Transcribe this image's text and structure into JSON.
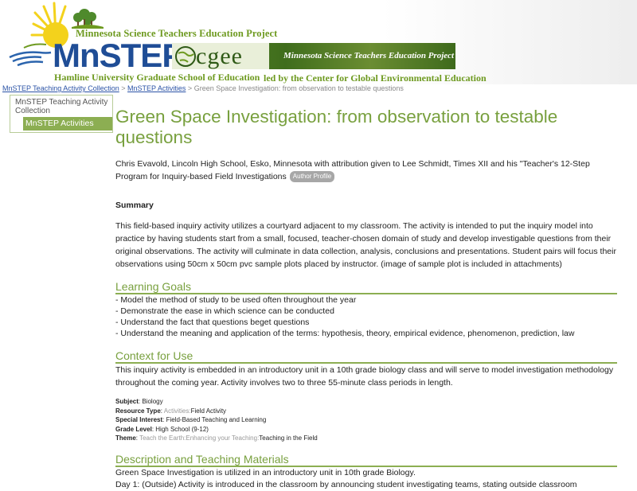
{
  "header": {
    "project_top": "Minnesota Science Teachers Education Project",
    "logo_word": "MnSTEP",
    "hamline": "Hamline University Graduate School of Education",
    "cgee_word": "cgee",
    "cgee_tagline": "Minnesota Science Teachers Education Project",
    "cgee_led_by": "led by the Center for Global Environmental Education",
    "colors": {
      "green": "#6e9a20",
      "blue": "#1f4d96",
      "sun": "#f3d21c"
    }
  },
  "breadcrumb": {
    "items": [
      {
        "label": "MnSTEP Teaching Activity Collection",
        "link": true
      },
      {
        "label": "MnSTEP Activities",
        "link": true
      },
      {
        "label": "Green Space Investigation: from observation to testable questions",
        "link": false
      }
    ],
    "separator": ">"
  },
  "sidebar": {
    "parent": "MnSTEP Teaching Activity Collection",
    "current": "MnSTEP Activities"
  },
  "page": {
    "title": "Green Space Investigation: from observation to testable questions",
    "author": "Chris Evavold, Lincoln High School, Esko, Minnesota with attribution given to Lee Schmidt, Times XII and his \"Teacher's 12-Step Program for Inquiry-based Field Investigations",
    "author_button": "Author Profile",
    "summary_heading": "Summary",
    "summary": "This field-based inquiry activity utilizes a courtyard adjacent to my classroom. The activity is intended to put the inquiry model into practice by having students start from a small, focused, teacher-chosen domain of study and develop investigable questions from their original observations. The activity will culminate in data collection, analysis, conclusions and presentations. Student pairs will focus their observations using 50cm x 50cm pvc sample plots placed by instructor. (image of sample plot is included in attachments)",
    "learning_goals_heading": "Learning Goals",
    "learning_goals": [
      "- Model the method of study to be used often throughout the year",
      "- Demonstrate the ease in which science can be conducted",
      "- Understand the fact that questions beget questions",
      "- Understand the meaning and application of the terms: hypothesis, theory, empirical evidence, phenomenon, prediction, law"
    ],
    "context_heading": "Context for Use",
    "context": "This inquiry activity is embedded in an introductory unit in a 10th grade biology class and will serve to model investigation methodology throughout the coming year. Activity involves two to three 55-minute class periods in length.",
    "meta": {
      "subject_label": "Subject",
      "subject": "Biology",
      "resource_label": "Resource Type",
      "resource_prefix": "Activities:",
      "resource": "Field Activity",
      "interest_label": "Special Interest",
      "interest": "Field-Based Teaching and Learning",
      "grade_label": "Grade Level",
      "grade": "High School (9-12)",
      "theme_label": "Theme",
      "theme_prefix": "Teach the Earth:Enhancing your Teaching:",
      "theme": "Teaching in the Field"
    },
    "description_heading": "Description and Teaching Materials",
    "description": [
      "Green Space Investigation is utilized in an introductory unit in 10th grade Biology.",
      "Day 1: (Outside) Activity is introduced in the classroom by announcing student investigating teams, stating outside classroom"
    ]
  }
}
